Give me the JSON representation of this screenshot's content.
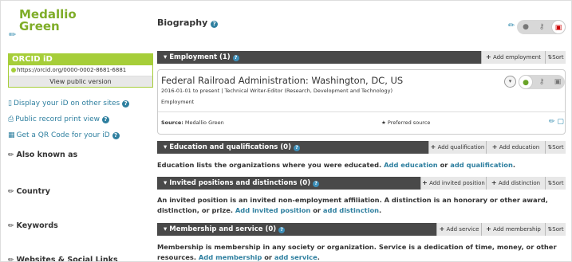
{
  "sidebar": {
    "name_line1": "Medallio",
    "name_line2": "Green",
    "orcid_title": "ORCID iD",
    "orcid_url": "https://orcid.org/0000-0002-8681-6881",
    "view_public": "View public version",
    "links": [
      {
        "label": "Display your iD on other sites",
        "icon": "mobile-icon"
      },
      {
        "label": "Public record print view",
        "icon": "printer-icon"
      },
      {
        "label": "Get a QR Code for your iD",
        "icon": "qr-code-icon"
      }
    ],
    "sections": [
      "Also known as",
      "Country",
      "Keywords",
      "Websites & Social Links"
    ]
  },
  "biography": {
    "title": "Biography"
  },
  "employment": {
    "title": "Employment (1)",
    "add_label": "Add employment",
    "sort_label": "Sort",
    "item": {
      "org": "Federal Railroad Administration: Washington, DC, US",
      "date_role": "2016-01-01 to present | Technical Writer-Editor (Research, Development and Technology)",
      "type": "Employment",
      "source_label": "Source:",
      "source": "Medallio Green",
      "preferred": "Preferred source"
    }
  },
  "education": {
    "title": "Education and qualifications (0)",
    "add_qual": "Add qualification",
    "add_edu": "Add education",
    "sort_label": "Sort",
    "desc": "Education lists the organizations where you were educated.",
    "link1": "Add education",
    "or": "or",
    "link2": "add qualification",
    "end": "."
  },
  "invited": {
    "title": "Invited positions and distinctions (0)",
    "add_pos": "Add invited position",
    "add_dist": "Add distinction",
    "sort_label": "Sort",
    "desc": "An invited position is an invited non-employment affiliation. A distinction is an honorary or other award, distinction, or prize.",
    "link1": "Add invited position",
    "or": "or",
    "link2": "add distinction",
    "end": "."
  },
  "membership": {
    "title": "Membership and service (0)",
    "add_service": "Add service",
    "add_membership": "Add membership",
    "sort_label": "Sort",
    "desc": "Membership is membership in any society or organization. Service is a dedication of time, money, or other resources.",
    "link1": "Add membership",
    "or": "or",
    "link2": "add service",
    "end": "."
  },
  "colors": {
    "orcid_green": "#a6ce39",
    "name_green": "#7fad28",
    "link_blue": "#2e7f9f",
    "bar_dark": "#494949"
  }
}
